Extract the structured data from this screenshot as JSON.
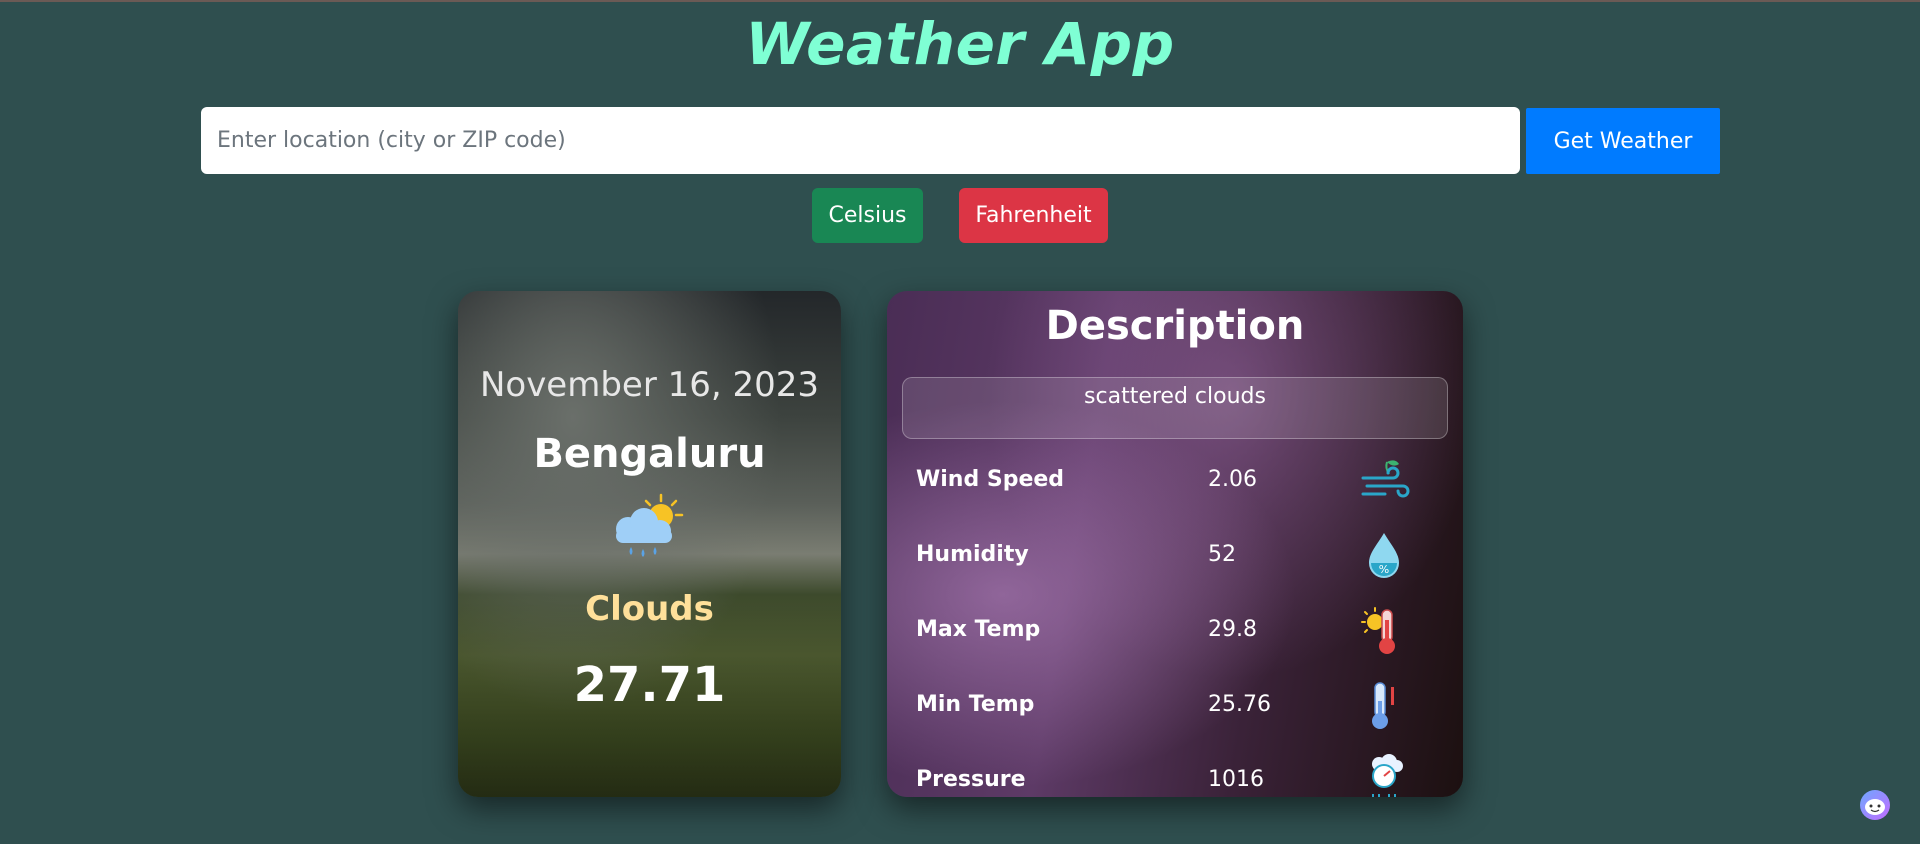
{
  "app": {
    "title": "Weather App"
  },
  "search": {
    "placeholder": "Enter location (city or ZIP code)",
    "value": "",
    "button_label": "Get Weather"
  },
  "units": {
    "celsius_label": "Celsius",
    "fahrenheit_label": "Fahrenheit"
  },
  "summary": {
    "date": "November 16, 2023",
    "city": "Bengaluru",
    "condition": "Clouds",
    "temperature": "27.71",
    "icon": "rain-cloud-sun-icon"
  },
  "details": {
    "title": "Description",
    "description": "scattered clouds",
    "stats": [
      {
        "label": "Wind Speed",
        "value": "2.06",
        "icon": "wind-icon"
      },
      {
        "label": "Humidity",
        "value": "52",
        "icon": "humidity-drop-icon"
      },
      {
        "label": "Max Temp",
        "value": "29.8",
        "icon": "thermometer-hot-icon"
      },
      {
        "label": "Min Temp",
        "value": "25.76",
        "icon": "thermometer-cold-icon"
      },
      {
        "label": "Pressure",
        "value": "1016",
        "icon": "pressure-gauge-icon"
      }
    ]
  },
  "colors": {
    "background": "#2f4f4f",
    "title": "#7fffd4",
    "primary": "#007bff",
    "success": "#198754",
    "danger": "#dc3545"
  }
}
